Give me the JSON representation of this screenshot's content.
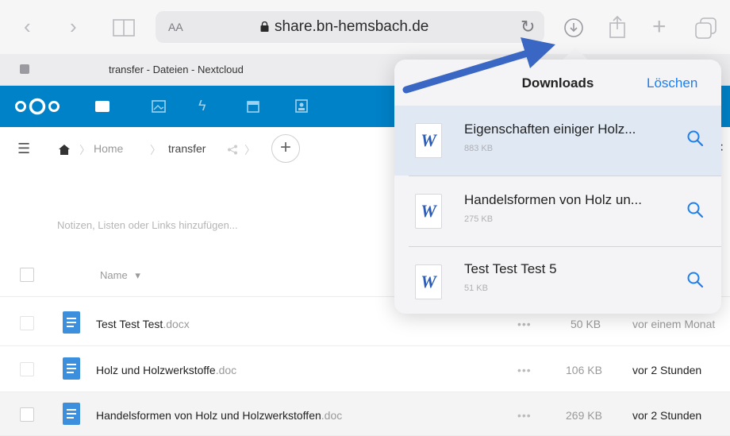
{
  "browser": {
    "url_aa_label": "AA",
    "url": "share.bn-hemsbach.de",
    "tab_title": "transfer - Dateien - Nextcloud"
  },
  "files_controls": {
    "breadcrumb_home": "Home",
    "breadcrumb_folder": "transfer",
    "add_label": "+"
  },
  "notes_placeholder": "Notizen, Listen oder Links hinzufügen...",
  "table_header": {
    "name_label": "Name",
    "sort_indicator": "▾"
  },
  "files": [
    {
      "base": "Test Test Test",
      "ext": ".docx",
      "actions": "•••",
      "size": "50 KB",
      "modified": "vor einem Monat"
    },
    {
      "base": "Holz und Holzwerkstoffe",
      "ext": ".doc",
      "actions": "•••",
      "size": "106 KB",
      "modified": "vor 2 Stunden"
    },
    {
      "base": "Handelsformen von Holz und Holzwerkstoffen",
      "ext": ".doc",
      "actions": "•••",
      "size": "269 KB",
      "modified": "vor 2 Stunden"
    }
  ],
  "downloads": {
    "title": "Downloads",
    "clear_label": "Löschen",
    "icon_letter": "W",
    "items": [
      {
        "name": "Eigenschaften einiger Holz...",
        "size": "883 KB"
      },
      {
        "name": "Handelsformen von Holz un...",
        "size": "275 KB"
      },
      {
        "name": "Test Test Test 5",
        "size": "51 KB"
      }
    ]
  },
  "colors": {
    "nextcloud_blue": "#0082c9",
    "link_blue": "#1a7ff0",
    "arrow_blue": "#3a66c4",
    "selected_row": "#dfe8f3"
  }
}
